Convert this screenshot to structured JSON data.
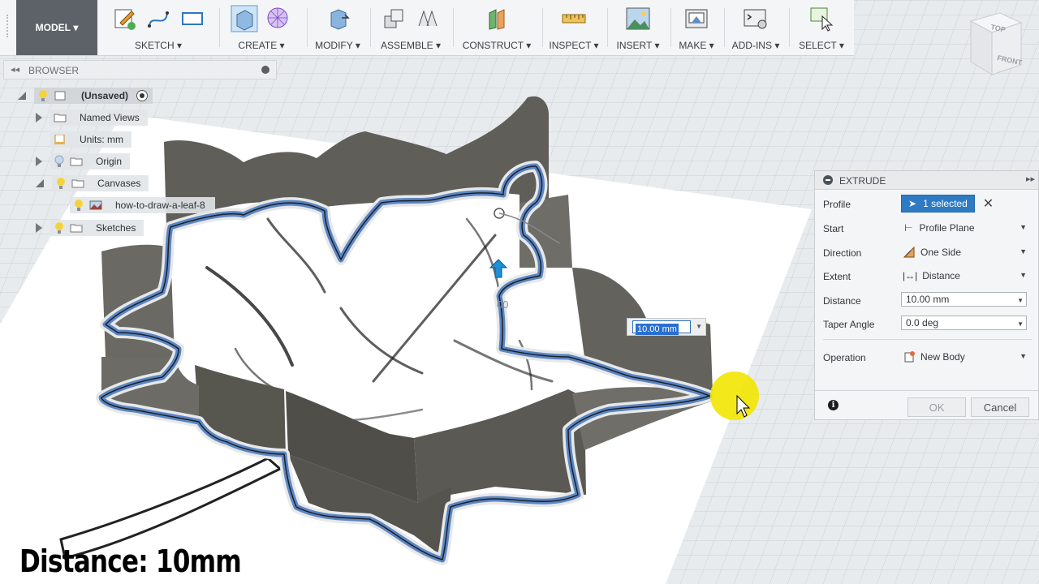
{
  "toolbar": {
    "workspace": "MODEL",
    "groups": [
      {
        "label": "SKETCH",
        "icons": [
          "sketch-edit-icon",
          "spline-icon",
          "rectangle-icon"
        ]
      },
      {
        "label": "CREATE",
        "icons": [
          "extrude-box-icon",
          "form-sphere-icon"
        ]
      },
      {
        "label": "MODIFY",
        "icons": [
          "press-pull-icon"
        ]
      },
      {
        "label": "ASSEMBLE",
        "icons": [
          "new-component-icon",
          "joint-icon"
        ]
      },
      {
        "label": "CONSTRUCT",
        "icons": [
          "offset-plane-icon"
        ]
      },
      {
        "label": "INSPECT",
        "icons": [
          "measure-icon"
        ]
      },
      {
        "label": "INSERT",
        "icons": [
          "insert-image-icon"
        ]
      },
      {
        "label": "MAKE",
        "icons": [
          "3d-print-icon"
        ]
      },
      {
        "label": "ADD-INS",
        "icons": [
          "scripts-icon"
        ]
      },
      {
        "label": "SELECT",
        "icons": [
          "select-arrow-icon"
        ]
      }
    ]
  },
  "viewcube": {
    "top": "TOP",
    "front": "FRONT"
  },
  "browser": {
    "title": "BROWSER",
    "items": [
      {
        "label": "(Unsaved)"
      },
      {
        "label": "Named Views"
      },
      {
        "label": "Units: mm"
      },
      {
        "label": "Origin"
      },
      {
        "label": "Canvases"
      },
      {
        "label": "how-to-draw-a-leaf-8"
      },
      {
        "label": "Sketches"
      }
    ]
  },
  "extrude": {
    "title": "EXTRUDE",
    "rows": {
      "profile": {
        "label": "Profile",
        "value": "1 selected"
      },
      "start": {
        "label": "Start",
        "value": "Profile Plane"
      },
      "direction": {
        "label": "Direction",
        "value": "One Side"
      },
      "extent": {
        "label": "Extent",
        "value": "Distance"
      },
      "distance": {
        "label": "Distance",
        "value": "10.00 mm"
      },
      "taper": {
        "label": "Taper Angle",
        "value": "0.0 deg"
      },
      "operation": {
        "label": "Operation",
        "value": "New Body"
      }
    },
    "ok": "OK",
    "cancel": "Cancel"
  },
  "canvas": {
    "distance_input": "10.00 mm",
    "ghost_value": "00",
    "caption": "Distance: 10mm"
  },
  "colors": {
    "profile_blue": "#5b86c4",
    "wall": "#5e5e5a",
    "select_blue": "#2e7bc4",
    "cursor_highlight": "#f2e500"
  }
}
